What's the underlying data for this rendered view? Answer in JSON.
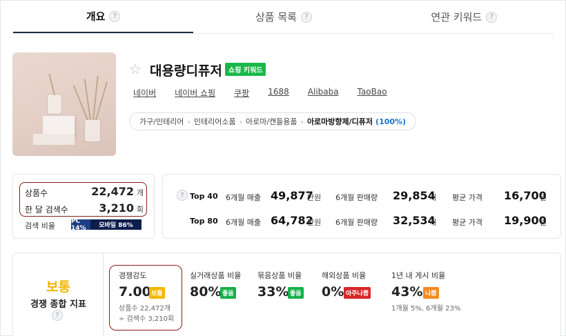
{
  "tabs": [
    {
      "label": "개요",
      "active": true
    },
    {
      "label": "상품 목록",
      "active": false
    },
    {
      "label": "연관 키워드",
      "active": false
    }
  ],
  "help_glyph": "?",
  "product": {
    "title": "대용량디퓨저",
    "badge": "쇼핑 키워드",
    "links": [
      "네이버",
      "네이버 쇼핑",
      "쿠팡",
      "1688",
      "Alibaba",
      "TaoBao"
    ],
    "breadcrumb": [
      "가구/인테리어",
      "인테리어소품",
      "아로마/캔들용품",
      "아로마방향제/디퓨저"
    ],
    "breadcrumb_pct": "(100%)"
  },
  "left_stats": {
    "product_count_label": "상품수",
    "product_count": "22,472",
    "product_count_unit": "개",
    "monthly_search_label": "한 달 검색수",
    "monthly_search": "3,210",
    "monthly_search_unit": "회",
    "search_ratio_label": "검색 비율",
    "pc_label": "PC 14%",
    "mobile_label": "모바일 86%",
    "pc_ratio": 14,
    "mobile_ratio": 86
  },
  "top_stats": [
    {
      "label": "Top 40",
      "sales_label": "6개월 매출",
      "sales": "49,877",
      "sales_unit": "만원",
      "qty_label": "6개월 판매량",
      "qty": "29,854",
      "qty_unit": "개",
      "price_label": "평균 가격",
      "price": "16,700",
      "price_unit": "원"
    },
    {
      "label": "Top 80",
      "sales_label": "6개월 매출",
      "sales": "64,782",
      "sales_unit": "만원",
      "qty_label": "6개월 판매량",
      "qty": "32,534",
      "qty_unit": "개",
      "price_label": "평균 가격",
      "price": "19,900",
      "price_unit": "원"
    }
  ],
  "competition": {
    "grade": "보통",
    "grade_label": "경쟁 종합 지표",
    "metrics": [
      {
        "label": "경쟁강도",
        "value": "7.00",
        "tag": "보통",
        "tag_color": "yellow",
        "sub1": "상품수 22,472개",
        "sub2": "÷ 검색수 3,210회"
      },
      {
        "label": "실거래상품 비율",
        "value": "80%",
        "tag": "좋음",
        "tag_color": "green"
      },
      {
        "label": "묶음상품 비율",
        "value": "33%",
        "tag": "좋음",
        "tag_color": "green"
      },
      {
        "label": "해외상품 비율",
        "value": "0%",
        "tag": "아주나쁨",
        "tag_color": "red"
      },
      {
        "label": "1년 내 게시 비율",
        "value": "43%",
        "tag": "나쁨",
        "tag_color": "orange",
        "sub1": "1개월 5%, 6개월 23%"
      }
    ]
  },
  "colors": {
    "accent_green": "#19b84a",
    "grade_yellow": "#f0b400",
    "highlight_red": "#8b1a1a",
    "pc_blue": "#1b3e86",
    "mobile_navy": "#0b1e4d"
  }
}
